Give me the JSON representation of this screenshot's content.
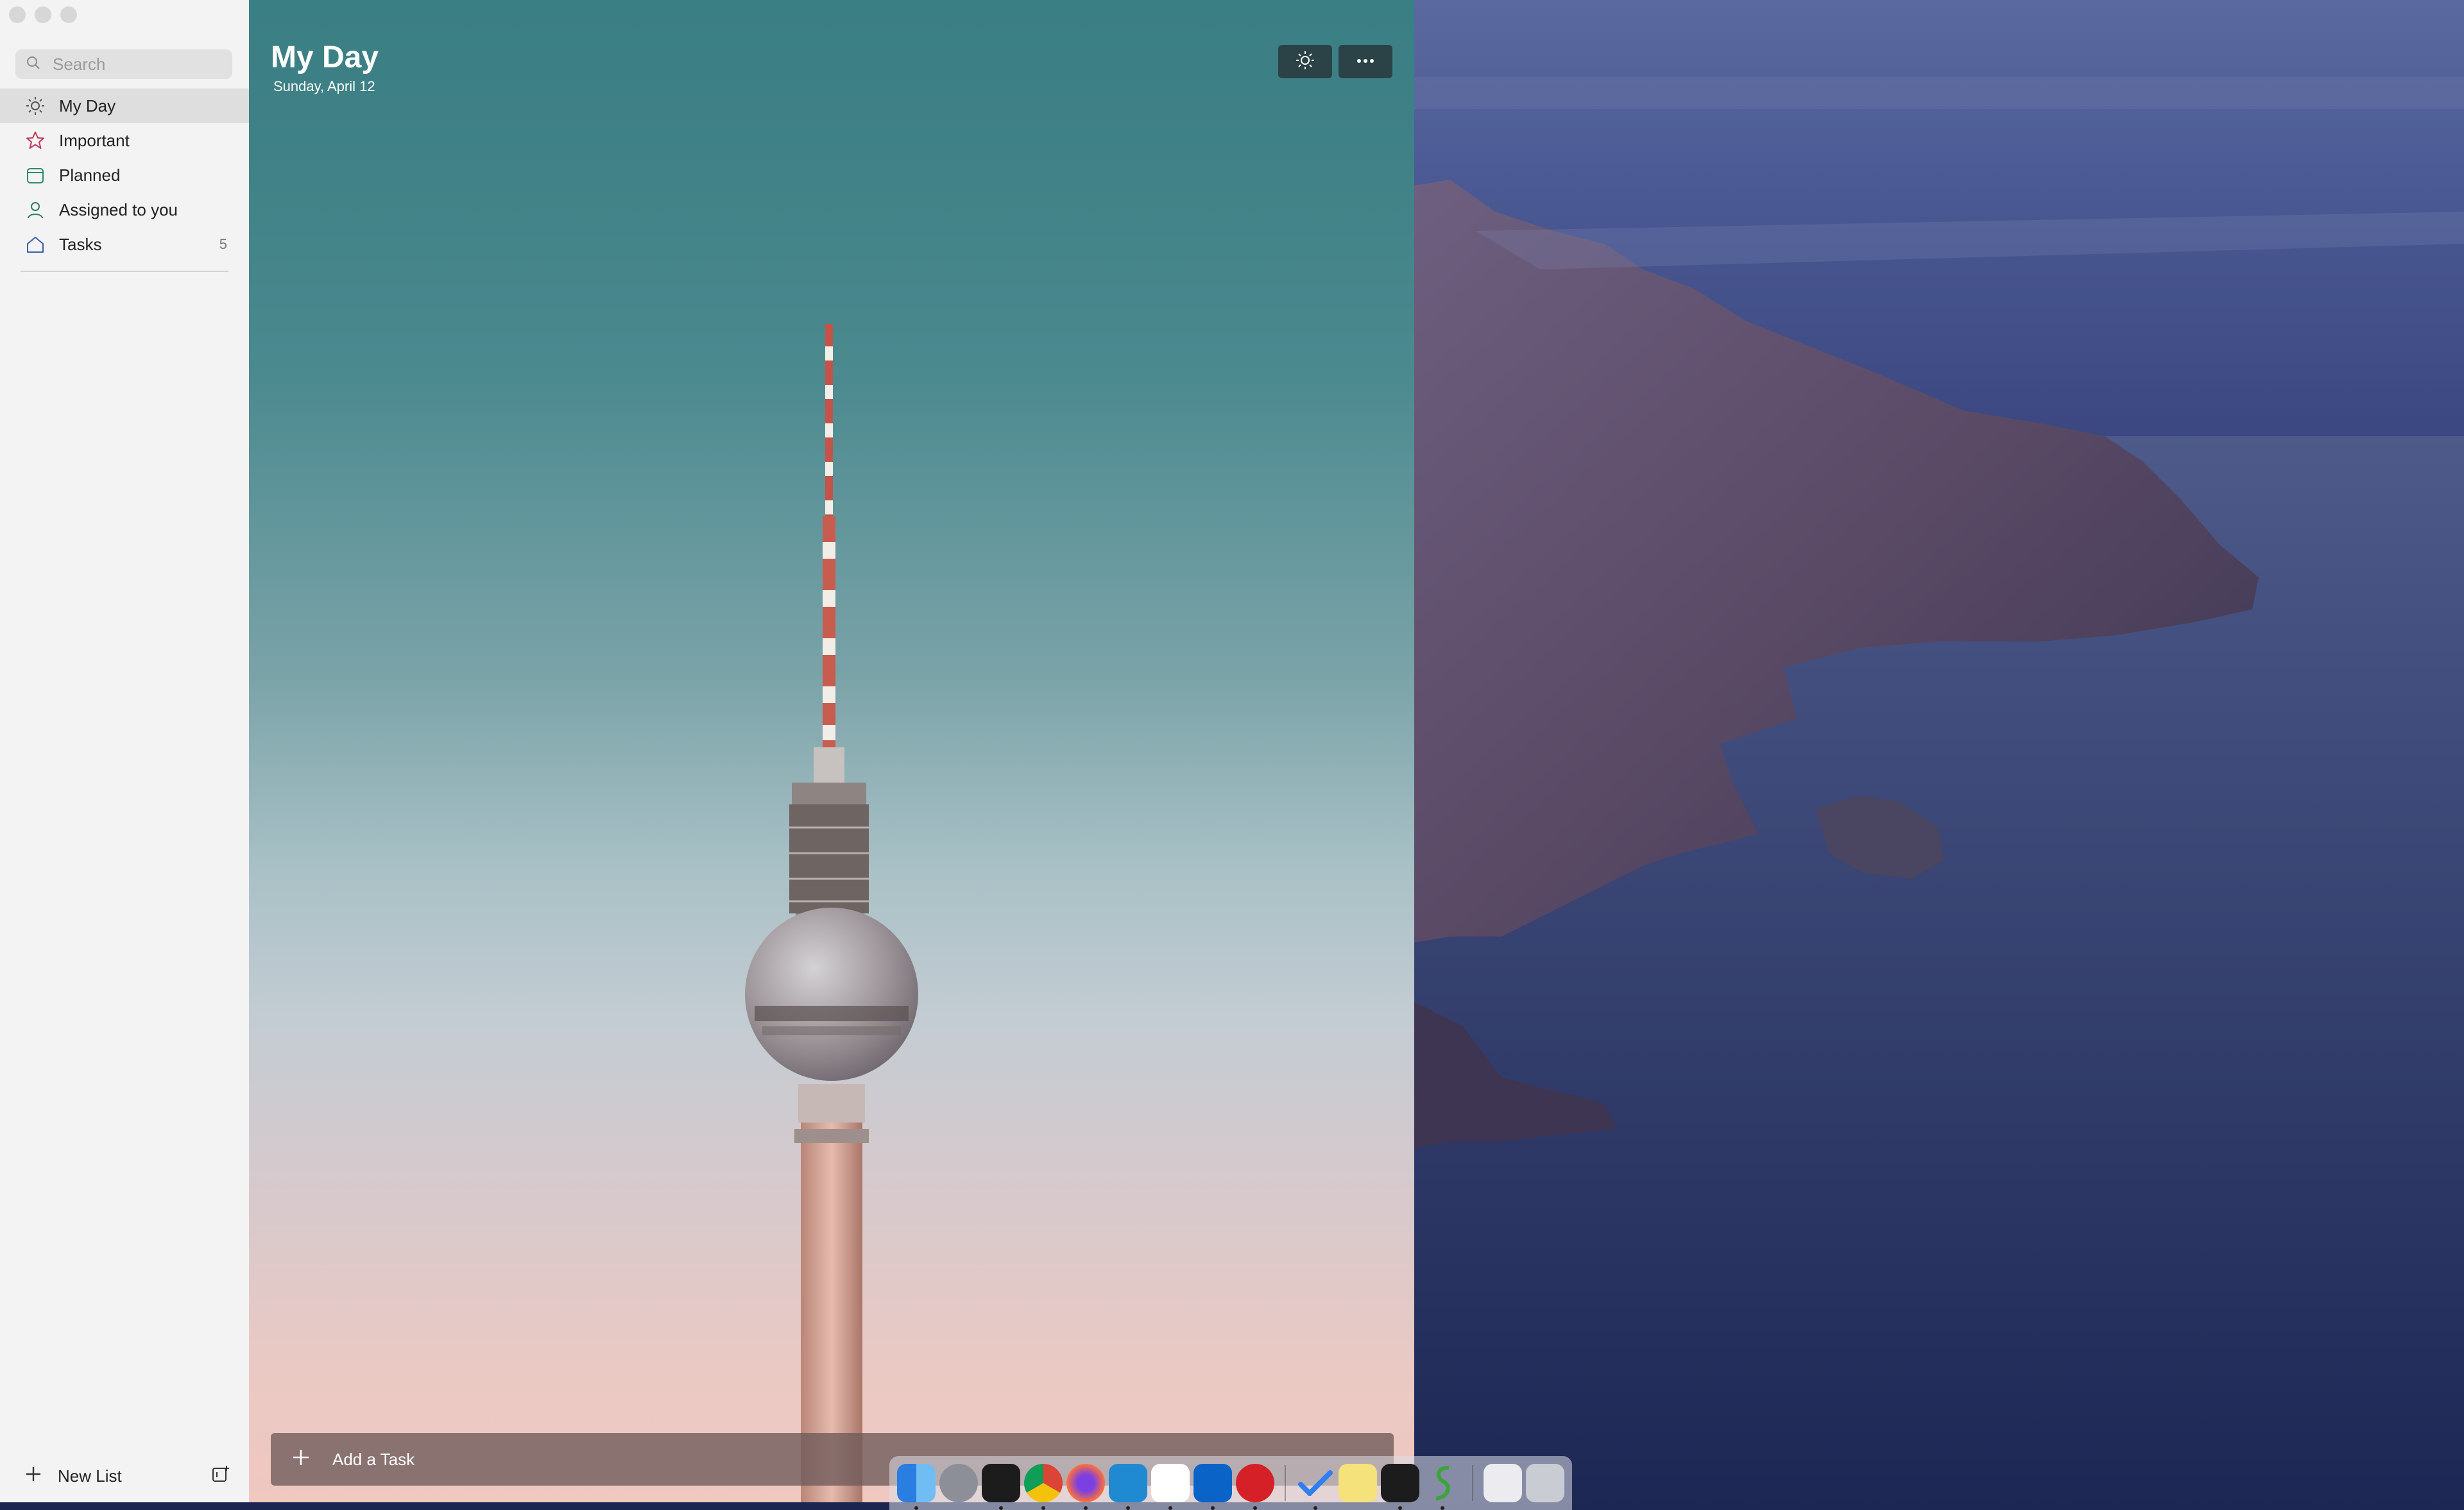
{
  "sidebar": {
    "search_placeholder": "Search",
    "items": [
      {
        "label": "My Day",
        "icon": "sun-icon",
        "count": ""
      },
      {
        "label": "Important",
        "icon": "star-icon",
        "count": ""
      },
      {
        "label": "Planned",
        "icon": "calendar-icon",
        "count": ""
      },
      {
        "label": "Assigned to you",
        "icon": "person-icon",
        "count": ""
      },
      {
        "label": "Tasks",
        "icon": "home-icon",
        "count": "5"
      }
    ],
    "new_list_label": "New List"
  },
  "main": {
    "title": "My Day",
    "date": "Sunday, April 12",
    "add_task_label": "Add a Task"
  },
  "colors": {
    "accent_important": "#c0395b",
    "accent_planned": "#2d8a6e",
    "accent_assigned": "#2e7d67",
    "accent_tasks": "#3f5ea8"
  },
  "dock": {
    "apps": [
      "finder-icon",
      "launchpad-icon",
      "terminal-icon",
      "chrome-icon",
      "firefox-icon",
      "vscode-icon",
      "slack-icon",
      "outlook-icon",
      "adobe-cloud-icon",
      "todo-icon",
      "stickies-icon",
      "terminal2-icon",
      "script-editor-icon",
      "finder-drive-icon",
      "trash-icon"
    ]
  }
}
